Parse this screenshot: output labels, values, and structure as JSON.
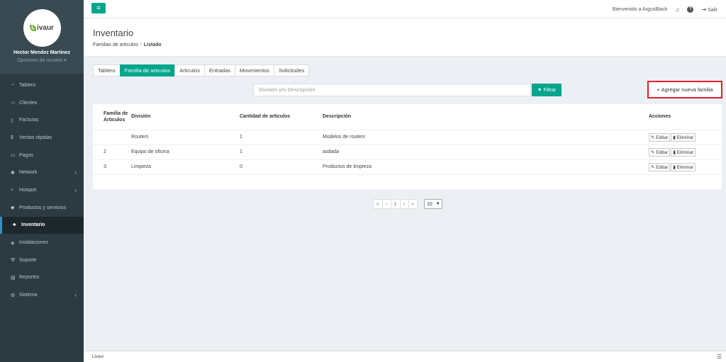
{
  "app": {
    "brand": "Livaur",
    "brand_leaf": "L",
    "brand_rest": "ivaur"
  },
  "user": {
    "name": "Hector Mendez Martinez",
    "options": "Opciones de usuario ▾"
  },
  "sidebar": {
    "items": [
      {
        "label": "Tablero",
        "icon": "dashboard-icon",
        "glyph": "◔",
        "chevron": ""
      },
      {
        "label": "Clientes",
        "icon": "users-icon",
        "glyph": "☺",
        "chevron": ""
      },
      {
        "label": "Facturas",
        "icon": "file-icon",
        "glyph": "▯",
        "chevron": ""
      },
      {
        "label": "Ventas rápidas",
        "icon": "dollar-icon",
        "glyph": "$",
        "chevron": ""
      },
      {
        "label": "Pagos",
        "icon": "payment-icon",
        "glyph": "▭",
        "chevron": ""
      },
      {
        "label": "Network",
        "icon": "network-icon",
        "glyph": "✱",
        "chevron": "‹"
      },
      {
        "label": "Hotspot",
        "icon": "wifi-icon",
        "glyph": "≈",
        "chevron": "‹"
      },
      {
        "label": "Productos y servicios",
        "icon": "tag-icon",
        "glyph": "◆",
        "chevron": ""
      },
      {
        "label": "Inventario",
        "icon": "inventory-icon",
        "glyph": "♣",
        "chevron": "",
        "active": true
      },
      {
        "label": "Instalaciones",
        "icon": "install-icon",
        "glyph": "◈",
        "chevron": ""
      },
      {
        "label": "Soporte",
        "icon": "wrench-icon",
        "glyph": "⚒",
        "chevron": ""
      },
      {
        "label": "Reportes",
        "icon": "book-icon",
        "glyph": "▤",
        "chevron": ""
      },
      {
        "label": "Sistema",
        "icon": "cogs-icon",
        "glyph": "⚙",
        "chevron": "‹"
      }
    ]
  },
  "topbar": {
    "menu_toggle_glyph": "≡",
    "welcome": "Bienvenido a ArgusBlack",
    "bell_glyph": "♫",
    "help_glyph": "?",
    "logout_glyph": "⇥",
    "logout_label": "Salir"
  },
  "header": {
    "title": "Inventario",
    "breadcrumb": [
      "Familias de articulos",
      "Listado"
    ]
  },
  "tabs": [
    {
      "label": "Tablero"
    },
    {
      "label": "Familia de articulos",
      "active": true
    },
    {
      "label": "Articulos"
    },
    {
      "label": "Entradas"
    },
    {
      "label": "Movimientos"
    },
    {
      "label": "Solicitudes"
    }
  ],
  "search": {
    "placeholder": "División y/o Descripción",
    "filter_label": "▼ Filtrar"
  },
  "add_button": {
    "label": "+ Agregar nueva familia"
  },
  "table": {
    "headers": [
      "Familia de Articulos",
      "División",
      "Cantidad de articulos",
      "Descripción",
      "Acciones"
    ],
    "rows": [
      {
        "familia": "",
        "division": "Routers",
        "cantidad": "1",
        "descripcion": "Modelos de routers"
      },
      {
        "familia": "2",
        "division": "Equipo de oficina",
        "cantidad": "1",
        "descripcion": "asdada"
      },
      {
        "familia": "3",
        "division": "Limpieza",
        "cantidad": "0",
        "descripcion": "Productos de limpieza"
      }
    ],
    "edit_label": "✎ Editar",
    "delete_label": "▮ Eliminar"
  },
  "pagination": {
    "first": "«",
    "prev": "‹",
    "current": "1",
    "next": "›",
    "last": "»",
    "per_page": "10"
  },
  "footer": {
    "text": "Livaur",
    "icon_glyph": "☰"
  },
  "colors": {
    "accent": "#00a68c",
    "sidebar": "#2c3b41",
    "highlight_border": "#e11d2a"
  }
}
